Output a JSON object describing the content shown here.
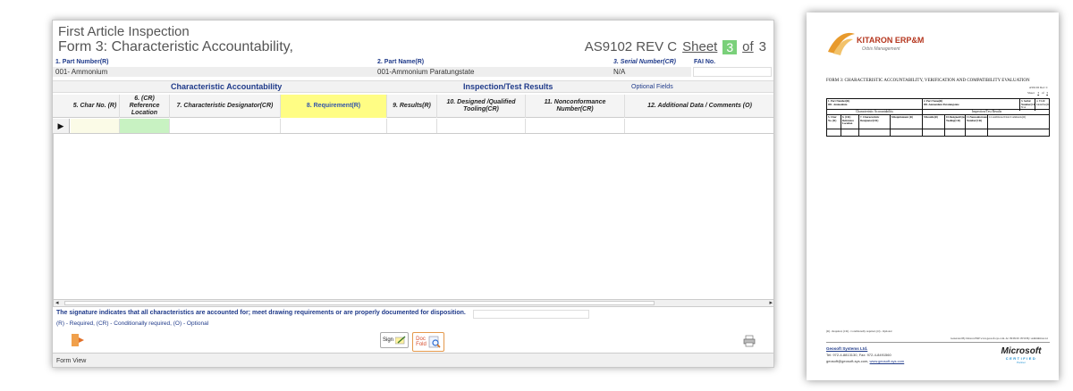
{
  "form": {
    "title_line1": "First Article Inspection",
    "title_line2": "Form 3: Characteristic Accountability,",
    "standard": "AS9102 REV C",
    "sheet_label": "Sheet",
    "sheet_no": "3",
    "of_label": "of",
    "total_sheets": "3"
  },
  "fields": {
    "part_number_label": "1. Part Number(R)",
    "part_number_value": "001- Ammonium",
    "part_name_label": "2. Part Name(R)",
    "part_name_value": "001-Ammonium Paratungstate",
    "serial_label": "3. Serial Number(CR)",
    "serial_value": "N/A",
    "fai_label": "FAI No."
  },
  "sections": {
    "char_acc": "Characteristic Accountability",
    "inspection": "Inspection/Test Results",
    "optional": "Optional Fields"
  },
  "columns": [
    "5. Char No. (R)",
    "6. (CR) Reference Location",
    "7. Characteristic Designator(CR)",
    "8. Requirement(R)",
    "9. Results(R)",
    "10. Designed /Qualified Tooling(CR)",
    "11. Nonconformance Number(CR)",
    "12. Additional Data / Comments (O)"
  ],
  "row_selector": "▶",
  "signature_text": "The signature indicates that all characteristics are accounted for; meet drawing requirements or are properly documented for disposition.",
  "legend_text": "(R) - Required, (CR) - Conditionally required, (O) - Optional",
  "buttons": {
    "sign": "Sign",
    "doc_fold_1": "Doc",
    "doc_fold_2": "Fold"
  },
  "statusbar": "Form View",
  "colors": {
    "required_header": "#fffd84",
    "required_cell": "#c8f2c2",
    "optional_cell": "#fbfbe7",
    "sheet_badge": "#7ad07a",
    "label_blue": "#1f3a8a"
  },
  "document": {
    "logo_title": "KITARON ERP&MES",
    "logo_sub": "Orbis Management",
    "heading": "FORM 3: CHARACTERISTIC ACCOUNTABILITY, VERIFICATION AND COMPATIBILITY EVALUATION",
    "rev": "AS9102 Rev C",
    "sheet": "Sheet",
    "sheet_no": "3",
    "of": "of",
    "of_no": "3",
    "part_number": "1. Part Number(R)",
    "part_number_value": "001- Ammonium",
    "part_name": "2. Part Name(R)",
    "part_name_value": "001-Ammonium Paratungstate",
    "serial": "3. Serial Number(CR)",
    "serial_value": "N/A",
    "fai": "4. FAIR Identifier(R)",
    "char_acc": "Characteristic Accountability",
    "inspection": "Inspection/Test Results",
    "cols": [
      "5. Char No. (R)",
      "6. (CR) Reference Location",
      "7. Characteristic Designator(CR)",
      "8.Requirement (R)",
      "9.Results(R)",
      "10.Designed/Qualified Tooling(CR)",
      "11.Nonconformance Number(CR)",
      "12.Additional Data/Comments(O)"
    ],
    "footer_legend": "(R) - Required, (CR) - Conditionally required, (O) - Optional",
    "footer_generated": "Generated By Kitaron ERP www.geosoft-sys.com. At: 09/09/29 18:59   By: AdminKitaron1",
    "company": "Geosoft Systems Ltd.",
    "tel": "Tel: 972-4-8813130, Fax: 972-4-8491560",
    "email": "geosoft@geosoft-sys.com,",
    "website": "www.geosoft-sys.com",
    "ms_brand": "Microsoft",
    "ms_certified": "CERTIFIED",
    "ms_partner": "Partner"
  }
}
